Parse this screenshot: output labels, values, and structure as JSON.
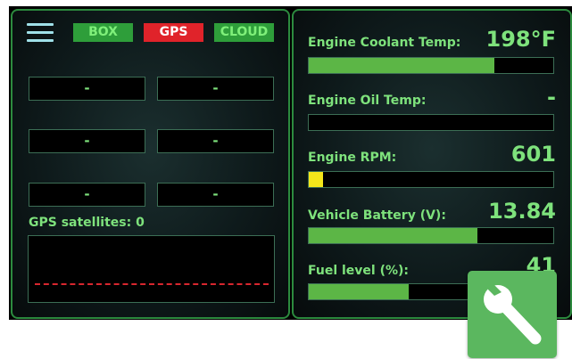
{
  "header": {
    "menu_icon": "hamburger-menu-icon",
    "tags": {
      "box": "BOX",
      "gps": "GPS",
      "cloud": "CLOUD"
    }
  },
  "fields": {
    "r1c1": "-",
    "r1c2": "-",
    "r2c1": "-",
    "r2c2": "-",
    "r3c1": "-",
    "r3c2": "-"
  },
  "satellites": {
    "label": "GPS satellites: 0"
  },
  "gauges": {
    "coolant": {
      "label": "Engine Coolant Temp:",
      "value": "198°F",
      "fill": 0.76
    },
    "oil": {
      "label": "Engine Oil Temp:",
      "value": "-",
      "fill": 0.0
    },
    "rpm": {
      "label": "Engine RPM:",
      "value": "601",
      "fill": 0.06
    },
    "battery": {
      "label": "Vehicle Battery (V):",
      "value": "13.84",
      "fill": 0.69
    },
    "fuel": {
      "label": "Fuel level (%):",
      "value": "41",
      "fill": 0.41
    }
  },
  "colors": {
    "bar_green": "#5cb646",
    "bar_yellow": "#f4e61a",
    "text_green": "#7ee27c",
    "alert_red": "#e0232a"
  },
  "fab": {
    "icon": "wrench-icon"
  }
}
